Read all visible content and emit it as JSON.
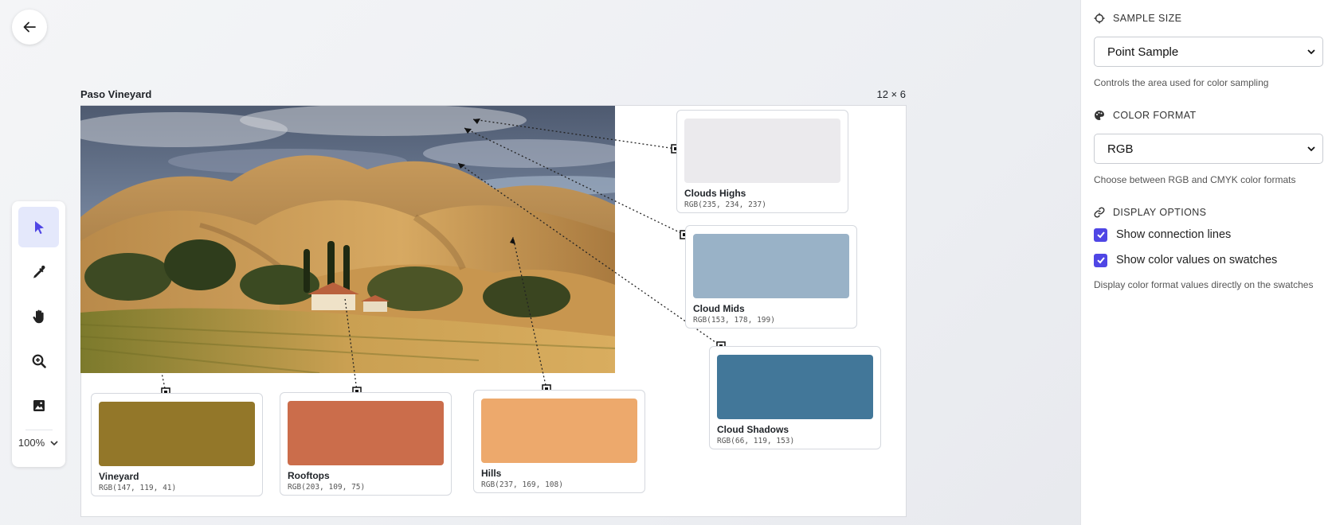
{
  "canvas": {
    "title": "Paso Vineyard",
    "size_label": "12 × 6"
  },
  "toolbar": {
    "tools": [
      "pointer-icon",
      "eyedropper-icon",
      "hand-icon",
      "zoom-icon",
      "image-icon"
    ],
    "active_tool": "pointer-icon",
    "zoom_label": "100%"
  },
  "swatches": [
    {
      "name": "Clouds Highs",
      "value": "RGB(235, 234, 237)",
      "color": "#ebeaed"
    },
    {
      "name": "Cloud Mids",
      "value": "RGB(153, 178, 199)",
      "color": "#99b2c7"
    },
    {
      "name": "Cloud Shadows",
      "value": "RGB(66, 119, 153)",
      "color": "#427799"
    },
    {
      "name": "Vineyard",
      "value": "RGB(147, 119, 41)",
      "color": "#937729"
    },
    {
      "name": "Rooftops",
      "value": "RGB(203, 109, 75)",
      "color": "#cb6d4b"
    },
    {
      "name": "Hills",
      "value": "RGB(237, 169, 108)",
      "color": "#eda96c"
    }
  ],
  "panel": {
    "sample_size": {
      "heading": "SAMPLE SIZE",
      "selected": "Point Sample",
      "hint": "Controls the area used for color sampling"
    },
    "color_format": {
      "heading": "COLOR FORMAT",
      "selected": "RGB",
      "hint": "Choose between RGB and CMYK color formats"
    },
    "display_options": {
      "heading": "DISPLAY OPTIONS",
      "show_lines_label": "Show connection lines",
      "show_lines_checked": true,
      "show_values_label": "Show color values on swatches",
      "show_values_checked": true,
      "hint": "Display color format values directly on the swatches"
    }
  },
  "colors": {
    "accent": "#4f46e5",
    "active_tool_bg": "#e4e8fb"
  }
}
